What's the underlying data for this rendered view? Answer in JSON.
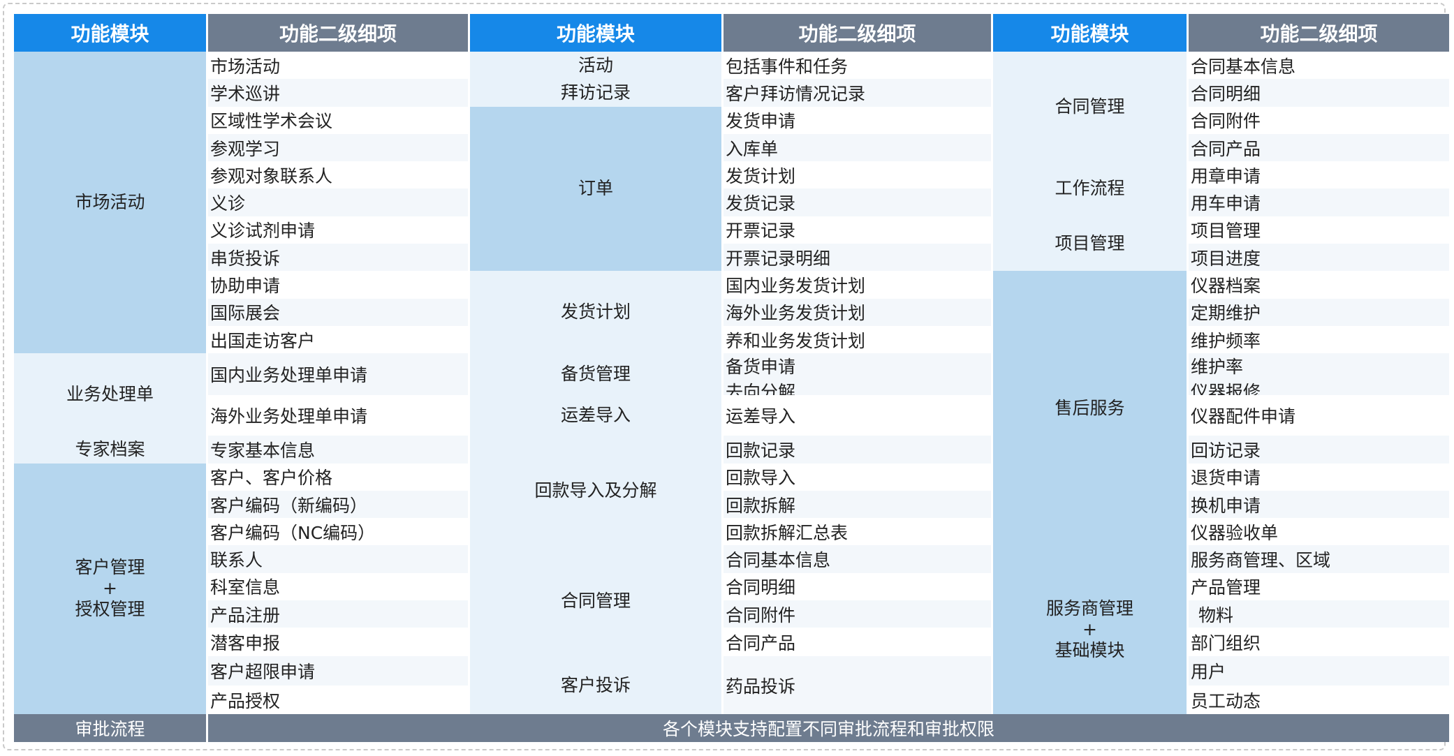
{
  "headers": {
    "module": "功能模块",
    "sub": "功能二级细项"
  },
  "col1": {
    "m1": "市场活动",
    "m1_items": [
      "市场活动",
      "学术巡讲",
      "区域性学术会议",
      "参观学习",
      "参观对象联系人",
      "义诊",
      "义诊试剂申请",
      "串货投诉",
      "协助申请",
      "国际展会",
      "出国走访客户"
    ],
    "m2": "业务处理单",
    "m2_items": [
      "国内业务处理单申请",
      "海外业务处理单申请"
    ],
    "m3": "专家档案",
    "m3_items": [
      "专家基本信息"
    ],
    "m4_l1": "客户管理",
    "m4_l2": "+",
    "m4_l3": "授权管理",
    "m4_items": [
      "客户、客户价格",
      "客户编码（新编码）",
      "客户编码（NC编码）",
      "联系人",
      "科室信息",
      "产品注册",
      "潜客申报",
      "客户超限申请",
      "产品授权"
    ]
  },
  "col2": {
    "m1": "活动",
    "m1_items": [
      "包括事件和任务"
    ],
    "m2": "拜访记录",
    "m2_items": [
      "客户拜访情况记录"
    ],
    "m3": "订单",
    "m3_items": [
      "发货申请",
      "入库单",
      "发货计划",
      "发货记录",
      "开票记录",
      "开票记录明细"
    ],
    "m4": "发货计划",
    "m4_items": [
      "国内业务发货计划",
      "海外业务发货计划",
      "养和业务发货计划"
    ],
    "m5": "备货管理",
    "m5_items": [
      "备货申请",
      "去向分解"
    ],
    "m6": "运差导入",
    "m6_items": [
      "运差导入"
    ],
    "m7": "回款导入及分解",
    "m7_items": [
      "回款记录",
      "回款导入",
      "回款拆解",
      "回款拆解汇总表"
    ],
    "m8": "合同管理",
    "m8_items": [
      "合同基本信息",
      "合同明细",
      "合同附件",
      "合同产品"
    ],
    "m9": "客户投诉",
    "m9_items": [
      "药品投诉"
    ]
  },
  "col3": {
    "m1": "合同管理",
    "m1_items": [
      "合同基本信息",
      "合同明细",
      "合同附件",
      "合同产品"
    ],
    "m2": "工作流程",
    "m2_items": [
      "用章申请",
      "用车申请"
    ],
    "m3": "项目管理",
    "m3_items": [
      "项目管理",
      "项目进度"
    ],
    "m4": "售后服务",
    "m4_items": [
      "仪器档案",
      "定期维护",
      "维护频率",
      "维护率",
      "仪器报修",
      "仪器配件申请",
      "回访记录",
      "退货申请",
      "换机申请",
      "仪器验收单"
    ],
    "m5_l1": "服务商管理",
    "m5_l2": "+",
    "m5_l3": "基础模块",
    "m5_items": [
      "服务商管理、区域",
      "产品管理",
      "物料",
      "部门组织",
      "用户",
      "员工动态"
    ]
  },
  "footer": {
    "label": "审批流程",
    "text": "各个模块支持配置不同审批流程和审批权限"
  },
  "colors": {
    "header_blue": "#1688e8",
    "header_gray": "#6e7c8f",
    "module_blue": "#b5d6ee",
    "module_light": "#e8f2fa"
  }
}
